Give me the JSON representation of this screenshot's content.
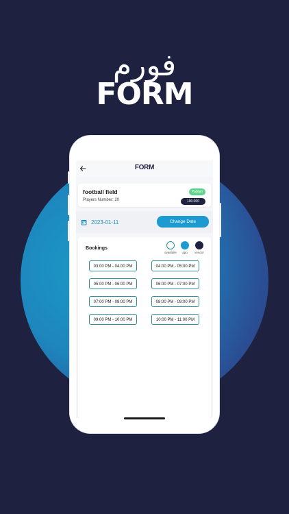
{
  "logo": {
    "arabic": "فورم",
    "latin": "FORM"
  },
  "app": {
    "brand": "FORM"
  },
  "field": {
    "title": "football field",
    "players": "Players Number: 20",
    "status": "Publish",
    "price": "100.000"
  },
  "date": {
    "value": "2023-01-11",
    "change_label": "Change Date"
  },
  "bookings": {
    "title": "Bookings",
    "legend": [
      {
        "label": "available",
        "color": "#ffffff"
      },
      {
        "label": "app",
        "color": "#1d9bd0"
      },
      {
        "label": "vendor",
        "color": "#1f2140"
      }
    ],
    "slots": [
      "03:00 PM - 04:00 PM",
      "04:00 PM - 05:00 PM",
      "05:00 PM - 06:00 PM",
      "06:00 PM - 07:00 PM",
      "07:00 PM - 08:00 PM",
      "08:00 PM - 09:00 PM",
      "09:00 PM - 10:00 PM",
      "10:00 PM - 11:00 PM"
    ]
  },
  "icons": {
    "back": "arrow-left-icon",
    "calendar": "calendar-icon"
  },
  "colors": {
    "background": "#1f2140",
    "accent": "#1d9bd0",
    "publish": "#5fd38d",
    "slot_border": "#2c8f9c"
  }
}
